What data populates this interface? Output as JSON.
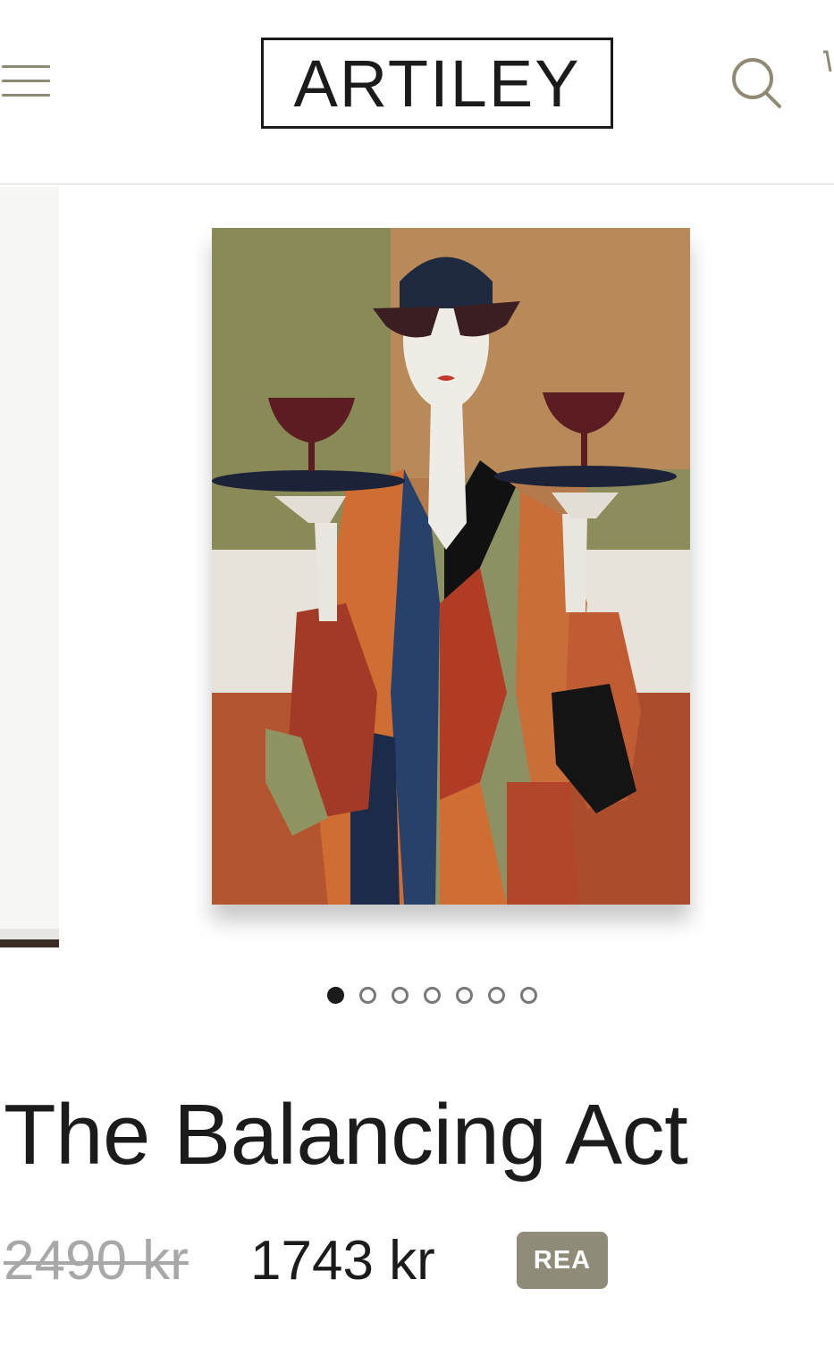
{
  "header": {
    "logo_text": "ARTILEY",
    "menu_icon": "hamburger-menu-icon",
    "search_icon": "search-icon",
    "cart_icon": "cart-icon"
  },
  "gallery": {
    "slide_count": 7,
    "active_index": 0,
    "painting_subject": "abstract figure with sunglasses balancing two wine glasses on trays"
  },
  "product": {
    "title": "The Balancing Act",
    "original_price": "2490 kr",
    "sale_price": "1743 kr",
    "badge": "REA"
  },
  "colors": {
    "accent": "#8e8c78",
    "icon": "#8f8a73",
    "text": "#1b1b1b",
    "muted": "#a8a8a8"
  }
}
